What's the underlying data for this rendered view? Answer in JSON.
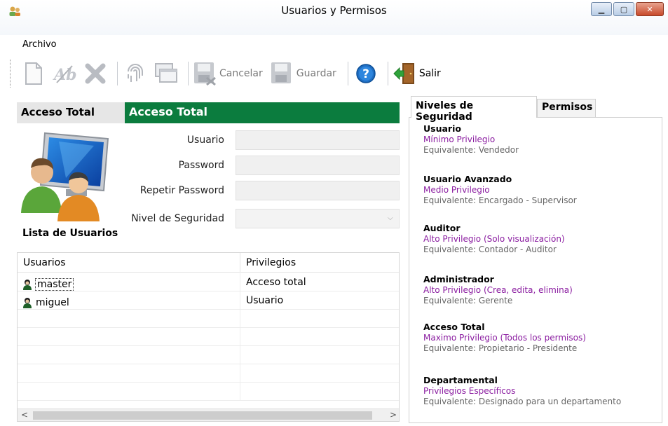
{
  "window": {
    "title": "Usuarios y Permisos"
  },
  "menu": {
    "archivo": "Archivo"
  },
  "toolbar": {
    "cancel_label": "Cancelar",
    "save_label": "Guardar",
    "exit_label": "Salir"
  },
  "header": {
    "left_title": "Acceso Total",
    "banner_title": "Acceso Total"
  },
  "form": {
    "usuario_label": "Usuario",
    "password_label": "Password",
    "repeat_password_label": "Repetir Password",
    "nivel_label": "Nivel de Seguridad"
  },
  "users_list": {
    "title": "Lista de Usuarios",
    "columns": [
      "Usuarios",
      "Privilegios"
    ],
    "rows": [
      {
        "user": "master",
        "privilege": "Acceso total"
      },
      {
        "user": "miguel",
        "privilege": "Usuario"
      }
    ]
  },
  "tabs": {
    "niveles": "Niveles de Seguridad",
    "permisos": "Permisos"
  },
  "levels": [
    {
      "name": "Usuario",
      "privilege": "Mínimo Privilegio",
      "equivalent": "Equivalente:  Vendedor"
    },
    {
      "name": "Usuario Avanzado",
      "privilege": "Medio Privilegio",
      "equivalent": "Equivalente:  Encargado - Supervisor"
    },
    {
      "name": "Auditor",
      "privilege": "Alto Privilegio (Solo visualización)",
      "equivalent": "Equivalente:  Contador - Auditor"
    },
    {
      "name": "Administrador",
      "privilege": "Alto Privilegio (Crea, edita, elimina)",
      "equivalent": "Equivalente:  Gerente"
    },
    {
      "name": "Acceso Total",
      "privilege": "Maximo Privilegio (Todos los permisos)",
      "equivalent": "Equivalente:  Propietario - Presidente"
    },
    {
      "name": "Departamental",
      "privilege": "Privilegios Específicos",
      "equivalent": "Equivalente:  Designado para un departamento"
    }
  ],
  "colors": {
    "banner": "#0b7c3e",
    "privilege_text": "#8a1ca0"
  }
}
